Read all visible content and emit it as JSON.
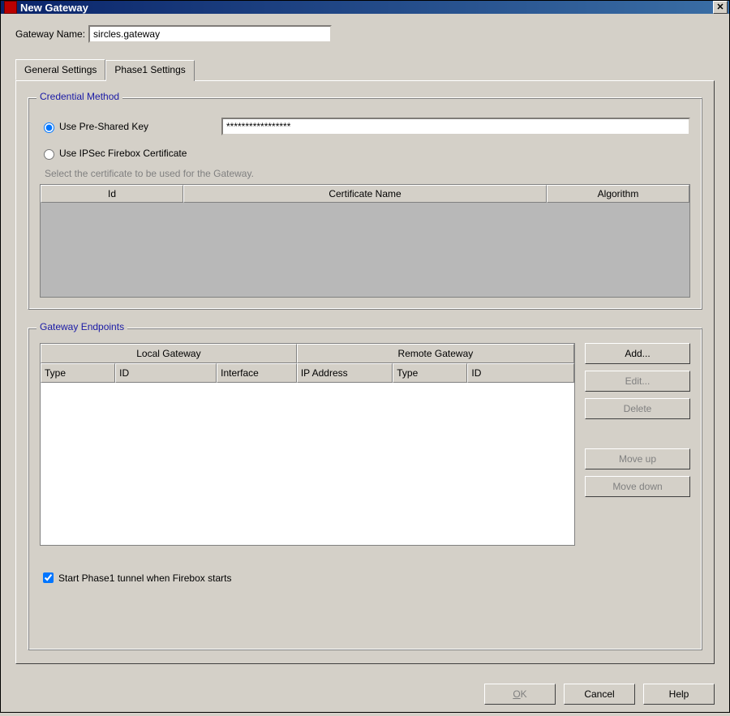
{
  "window": {
    "title": "New Gateway"
  },
  "gateway": {
    "name_label": "Gateway Name:",
    "name_value": "sircles.gateway"
  },
  "tabs": {
    "general": "General Settings",
    "phase1": "Phase1 Settings"
  },
  "credential": {
    "legend": "Credential Method",
    "psk_label": "Use Pre-Shared Key",
    "psk_value": "*****************",
    "cert_label": "Use IPSec Firebox Certificate",
    "cert_hint": "Select the certificate to be used for the Gateway.",
    "cols": {
      "id": "Id",
      "name": "Certificate Name",
      "algo": "Algorithm"
    }
  },
  "endpoints": {
    "legend": "Gateway Endpoints",
    "group_local": "Local Gateway",
    "group_remote": "Remote Gateway",
    "cols": {
      "type": "Type",
      "id": "ID",
      "iface": "Interface",
      "ip": "IP Address",
      "rtype": "Type",
      "rid": "ID"
    },
    "buttons": {
      "add": "Add...",
      "edit": "Edit...",
      "delete": "Delete",
      "up": "Move up",
      "down": "Move down"
    }
  },
  "start_tunnel_label": "Start Phase1 tunnel when Firebox starts",
  "buttons": {
    "ok_u": "O",
    "ok_rest": "K",
    "cancel": "Cancel",
    "help": "Help"
  }
}
